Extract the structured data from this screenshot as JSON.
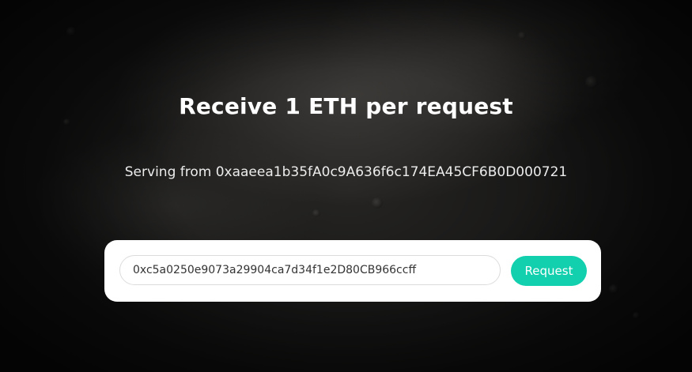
{
  "page": {
    "title": "Receive 1 ETH per request",
    "serving_text": "Serving from 0xaaeea1b35fA0c9A636f6c174EA45CF6B0D000721"
  },
  "form": {
    "address_value": "0xc5a0250e9073a29904ca7d34f1e2D80CB966ccff",
    "request_label": "Request"
  },
  "colors": {
    "accent": "#12cfae",
    "background": "#101010",
    "card": "#ffffff"
  }
}
